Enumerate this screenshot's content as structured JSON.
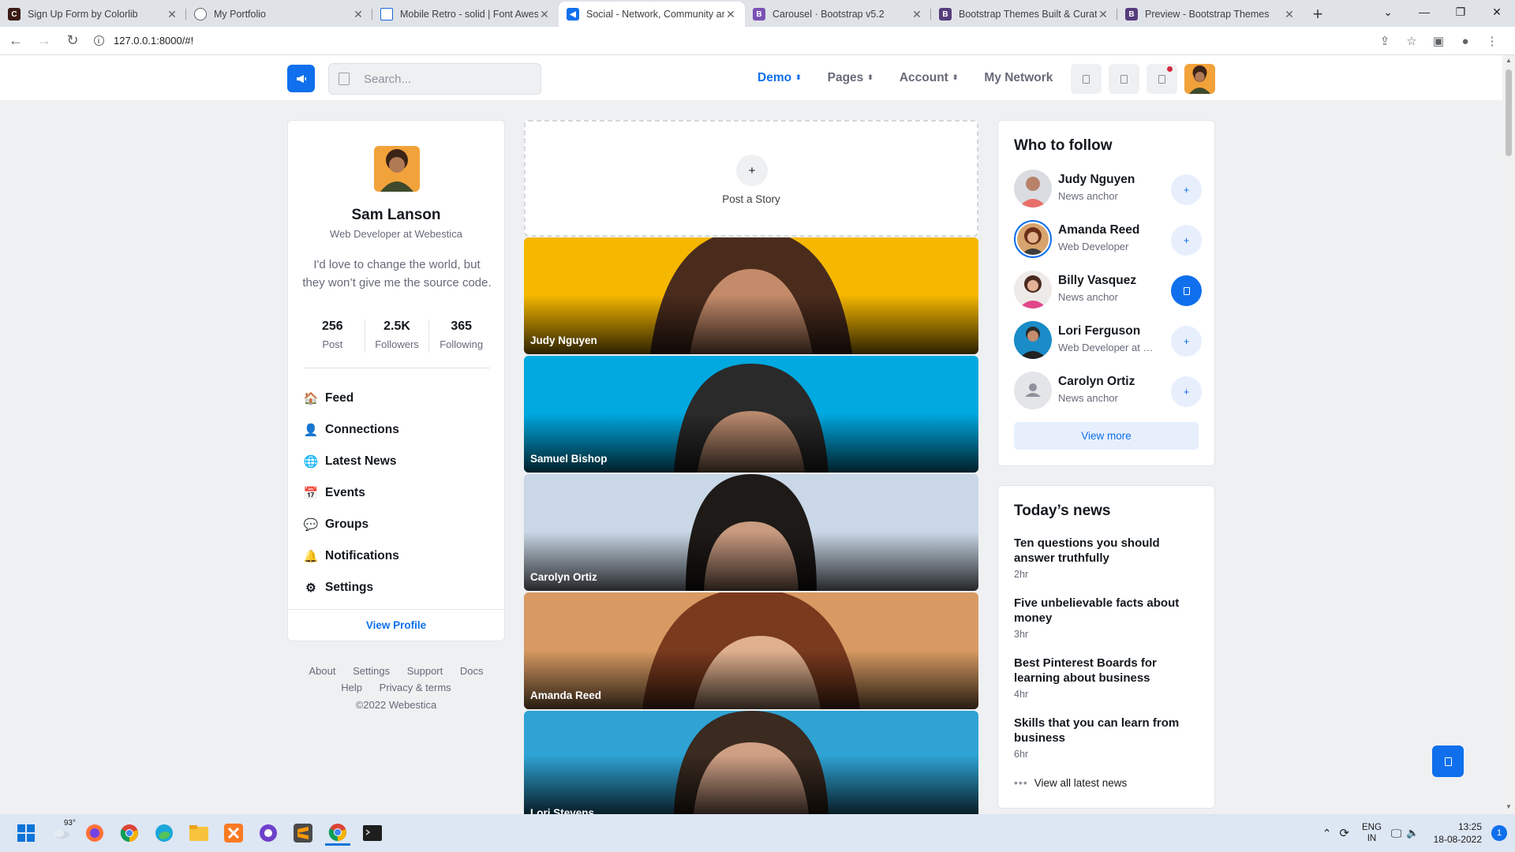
{
  "browser": {
    "tabs": [
      {
        "title": "Sign Up Form by Colorlib",
        "active": false,
        "favicon_color": "#3a1c14"
      },
      {
        "title": "My Portfolio",
        "active": false,
        "favicon_color": "#5f6368"
      },
      {
        "title": "Mobile Retro - solid | Font Awesome",
        "active": false,
        "favicon_color": "#1f66d6"
      },
      {
        "title": "Social - Network, Community and Event",
        "active": true,
        "favicon_color": "#0f6fec"
      },
      {
        "title": "Carousel · Bootstrap v5.2",
        "active": false,
        "favicon_color": "#7952b3"
      },
      {
        "title": "Bootstrap Themes Built & Curated",
        "active": false,
        "favicon_color": "#563d7c"
      },
      {
        "title": "Preview - Bootstrap Themes",
        "active": false,
        "favicon_color": "#563d7c"
      }
    ],
    "url": "127.0.0.1:8000/#!"
  },
  "header": {
    "search_placeholder": "Search...",
    "nav": [
      {
        "label": "Demo",
        "active": true,
        "caret": true
      },
      {
        "label": "Pages",
        "active": false,
        "caret": true
      },
      {
        "label": "Account",
        "active": false,
        "caret": true
      },
      {
        "label": "My Network",
        "active": false,
        "caret": false
      }
    ]
  },
  "profile": {
    "name": "Sam Lanson",
    "role": "Web Developer at Webestica",
    "bio": "I'd love to change the world, but they won’t give me the source code.",
    "stats": [
      {
        "value": "256",
        "label": "Post"
      },
      {
        "value": "2.5K",
        "label": "Followers"
      },
      {
        "value": "365",
        "label": "Following"
      }
    ],
    "menu": [
      {
        "label": "Feed",
        "icon": "home-icon"
      },
      {
        "label": "Connections",
        "icon": "person-icon"
      },
      {
        "label": "Latest News",
        "icon": "globe-icon"
      },
      {
        "label": "Events",
        "icon": "calendar-icon"
      },
      {
        "label": "Groups",
        "icon": "chat-icon"
      },
      {
        "label": "Notifications",
        "icon": "bell-icon"
      },
      {
        "label": "Settings",
        "icon": "gear-icon"
      }
    ],
    "view_profile": "View Profile"
  },
  "footer": {
    "links_row1": [
      "About",
      "Settings",
      "Support",
      "Docs"
    ],
    "links_row2": [
      "Help",
      "Privacy & terms"
    ],
    "copyright": "©2022 Webestica"
  },
  "stories": {
    "post_label": "Post a Story",
    "items": [
      {
        "name": "Judy Nguyen",
        "bg": "#f5b700"
      },
      {
        "name": "Samuel Bishop",
        "bg": "#00a9e0"
      },
      {
        "name": "Carolyn Ortiz",
        "bg": "#c9d7e6"
      },
      {
        "name": "Amanda Reed",
        "bg": "#d89a62"
      },
      {
        "name": "Lori Stevens",
        "bg": "#2ea3d4"
      }
    ]
  },
  "who_to_follow": {
    "title": "Who to follow",
    "items": [
      {
        "name": "Judy Nguyen",
        "role": "News anchor",
        "following": false
      },
      {
        "name": "Amanda Reed",
        "role": "Web Developer",
        "following": false
      },
      {
        "name": "Billy Vasquez",
        "role": "News anchor",
        "following": true
      },
      {
        "name": "Lori Ferguson",
        "role": "Web Developer at Webestica",
        "following": false
      },
      {
        "name": "Carolyn Ortiz",
        "role": "News anchor",
        "following": false
      }
    ],
    "view_more": "View more"
  },
  "news": {
    "title": "Today’s news",
    "items": [
      {
        "title": "Ten questions you should answer truthfully",
        "time": "2hr"
      },
      {
        "title": "Five unbelievable facts about money",
        "time": "3hr"
      },
      {
        "title": "Best Pinterest Boards for learning about business",
        "time": "4hr"
      },
      {
        "title": "Skills that you can learn from business",
        "time": "6hr"
      }
    ],
    "view_all": "View all latest news"
  },
  "taskbar": {
    "weather": "93°",
    "lang_line1": "ENG",
    "lang_line2": "IN",
    "time": "13:25",
    "date": "18-08-2022",
    "notification_count": "1"
  },
  "colors": {
    "primary": "#0f6fec",
    "body_bg": "#eef0f2",
    "text_muted": "#676a79"
  }
}
